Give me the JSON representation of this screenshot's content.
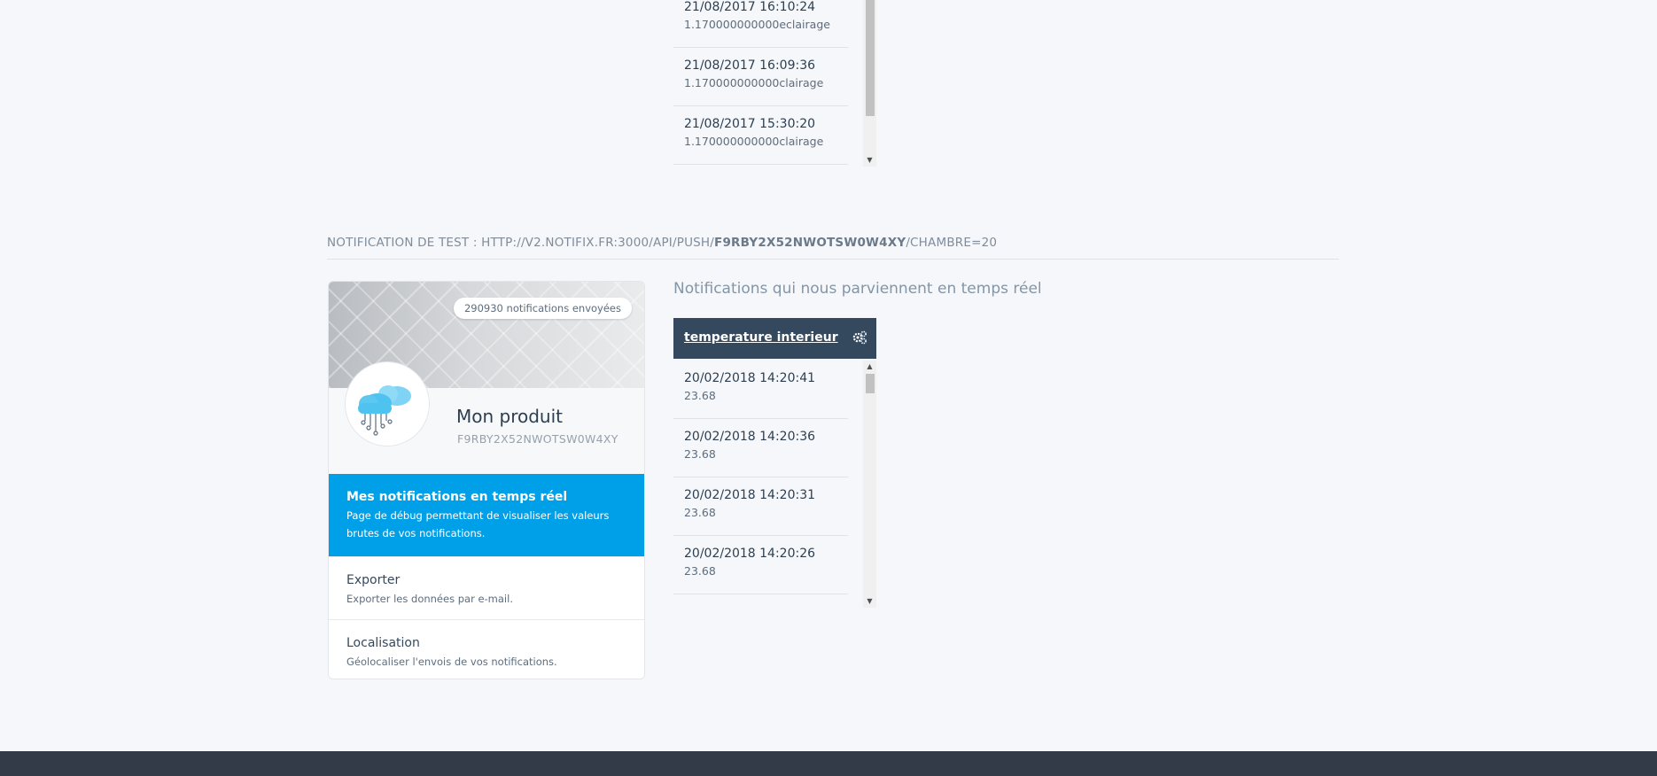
{
  "top_list": {
    "items": [
      {
        "date": "21/08/2017 16:10:24",
        "value": "1.170000000000eclairage"
      },
      {
        "date": "21/08/2017 16:09:36",
        "value": "1.170000000000clairage"
      },
      {
        "date": "21/08/2017 15:30:20",
        "value": "1.170000000000clairage"
      }
    ]
  },
  "test_notification": {
    "prefix": "NOTIFICATION DE TEST : HTTP://V2.NOTIFIX.FR:3000/API/PUSH/",
    "key": "F9RBY2X52NWOTSW0W4XY",
    "suffix": "/CHAMBRE=20"
  },
  "product": {
    "badge": "290930 notifications envoyées",
    "name": "Mon produit",
    "key": "F9RBY2X52NWOTSW0W4XY",
    "icon": "cloud-icon"
  },
  "menu": [
    {
      "title": "Mes notifications en temps réel",
      "description": "Page de débug permettant de visualiser les valeurs brutes de vos notifications.",
      "active": true
    },
    {
      "title": "Exporter",
      "description": "Exporter les données par e-mail.",
      "active": false
    },
    {
      "title": "Localisation",
      "description": "Géolocaliser l'envois de vos notifications.",
      "active": false
    }
  ],
  "realtime": {
    "heading": "Notifications qui nous parviennent en temps réel",
    "widget": {
      "title": "temperature interieur",
      "icon": "gears-icon",
      "items": [
        {
          "date": "20/02/2018 14:20:41",
          "value": "23.68"
        },
        {
          "date": "20/02/2018 14:20:36",
          "value": "23.68"
        },
        {
          "date": "20/02/2018 14:20:31",
          "value": "23.68"
        },
        {
          "date": "20/02/2018 14:20:26",
          "value": "23.68"
        }
      ]
    }
  },
  "colors": {
    "accent": "#00a0e9",
    "header_dark": "#34495e",
    "footer": "#323b47",
    "background": "#f5f7fa"
  }
}
